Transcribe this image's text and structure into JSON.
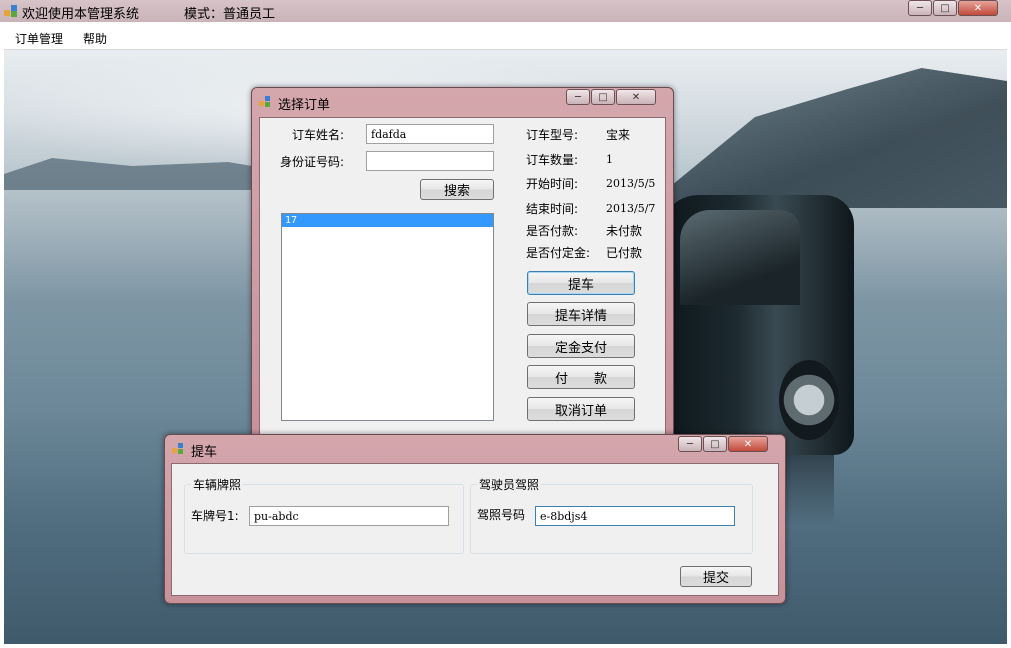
{
  "main_window": {
    "title": "欢迎使用本管理系统",
    "mode_text": "模式：普通员工",
    "menu": [
      "订单管理",
      "帮助"
    ]
  },
  "select_order_dialog": {
    "title": "选择订单",
    "name_label": "订车姓名:",
    "name_value": "fdafda",
    "id_label": "身份证号码:",
    "id_value": "",
    "search_button": "搜索",
    "list_items": [
      "17"
    ],
    "info": [
      {
        "label": "订车型号:",
        "value": "宝来"
      },
      {
        "label": "订车数量:",
        "value": "1"
      },
      {
        "label": "开始时间:",
        "value": "2013/5/5"
      },
      {
        "label": "结束时间:",
        "value": "2013/5/7"
      },
      {
        "label": "是否付款:",
        "value": "未付款"
      },
      {
        "label": "是否付定金:",
        "value": "已付款"
      }
    ],
    "buttons": {
      "pickup": "提车",
      "pickup_detail": "提车详情",
      "deposit_pay": "定金支付",
      "pay": "付　　款",
      "cancel_order": "取消订单"
    }
  },
  "pickup_dialog": {
    "title": "提车",
    "plate_group_title": "车辆牌照",
    "plate_label": "车牌号1:",
    "plate_value": "pu-abdc",
    "license_group_title": "驾驶员驾照",
    "license_label": "驾照号码",
    "license_value": "e-8bdjs4",
    "submit_button": "提交"
  },
  "colors": {
    "title_bar": "#c9b3b8",
    "dialog_frame": "#c79199",
    "client_bg": "#f0f0f0",
    "list_selection": "#3399ff"
  }
}
